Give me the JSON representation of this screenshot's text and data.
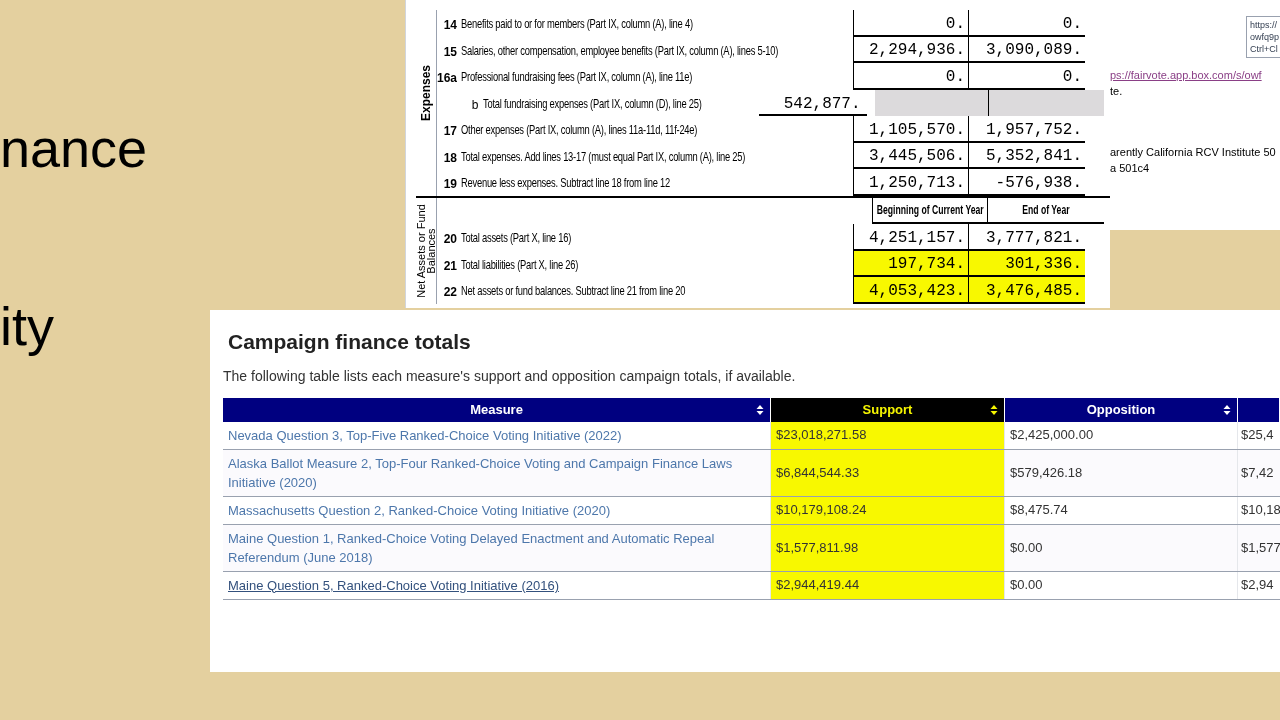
{
  "slide": {
    "texts": [
      "nance",
      "ity"
    ]
  },
  "form": {
    "sections": [
      {
        "label": "Expenses",
        "rows": [
          {
            "kind": "line",
            "number": "14",
            "text": "Benefits paid to or for members (Part IX, column (A), line 4)",
            "beginning": "0.",
            "end": "0.",
            "highlighted": false
          },
          {
            "kind": "line",
            "number": "15",
            "text": "Salaries, other compensation, employee benefits (Part IX, column (A), lines 5-10)",
            "beginning": "2,294,936.",
            "end": "3,090,089.",
            "highlighted": false
          },
          {
            "kind": "line",
            "number": "16a",
            "text": "Professional fundraising fees (Part IX, column (A), line 11e)",
            "beginning": "0.",
            "end": "0.",
            "highlighted": false
          },
          {
            "kind": "subline",
            "number": "b",
            "text": "Total fundraising expenses (Part IX, column (D), line 25)",
            "inner": "542,877."
          },
          {
            "kind": "line",
            "number": "17",
            "text": "Other expenses (Part IX, column (A), lines 11a-11d, 11f-24e)",
            "beginning": "1,105,570.",
            "end": "1,957,752.",
            "highlighted": false
          },
          {
            "kind": "line",
            "number": "18",
            "text": "Total expenses. Add lines 13-17 (must equal Part IX, column (A), line 25)",
            "beginning": "3,445,506.",
            "end": "5,352,841.",
            "highlighted": false
          },
          {
            "kind": "line",
            "number": "19",
            "text": "Revenue less expenses. Subtract line 18 from line 12",
            "beginning": "1,250,713.",
            "end": "-576,938.",
            "highlighted": false
          }
        ]
      },
      {
        "label": "Net Assets or Fund Balances",
        "rows": [
          {
            "kind": "header",
            "beginning": "Beginning of Current Year",
            "end": "End of Year"
          },
          {
            "kind": "line",
            "number": "20",
            "text": "Total assets (Part X, line 16)",
            "beginning": "4,251,157.",
            "end": "3,777,821.",
            "highlighted": false
          },
          {
            "kind": "line",
            "number": "21",
            "text": "Total liabilities (Part X, line 26)",
            "beginning": "197,734.",
            "end": "301,336.",
            "highlighted": true
          },
          {
            "kind": "line",
            "number": "22",
            "text": "Net assets or fund balances. Subtract line 21 from line 20",
            "beginning": "4,053,423.",
            "end": "3,476,485.",
            "highlighted": true
          }
        ]
      }
    ]
  },
  "note": {
    "tooltip": [
      "https://",
      "owfq9p",
      "Ctrl+Cl"
    ],
    "link": "ps://fairvote.app.box.com/s/owf",
    "lines": [
      "te.",
      "arently California RCV Institute 50",
      "a 501c4"
    ]
  },
  "web": {
    "title": "Campaign finance totals",
    "description": "The following table lists each measure's support and opposition campaign totals, if available.",
    "columns": [
      {
        "label": "Measure",
        "highlighted": false
      },
      {
        "label": "Support",
        "highlighted": true
      },
      {
        "label": "Opposition",
        "highlighted": false
      },
      {
        "highlighted": false
      }
    ],
    "rows": [
      {
        "measure": "Nevada Question 3, Top-Five Ranked-Choice Voting Initiative (2022)",
        "hovered": false,
        "support": "$23,018,271.58",
        "support_highlighted": true,
        "opposition": "$2,425,000.00",
        "column_4": "$25,4"
      },
      {
        "measure": "Alaska Ballot Measure 2, Top-Four Ranked-Choice Voting and Campaign Finance Laws Initiative (2020)",
        "hovered": false,
        "support": "$6,844,544.33",
        "support_highlighted": true,
        "opposition": "$579,426.18",
        "column_4": "$7,42"
      },
      {
        "measure": "Massachusetts Question 2, Ranked-Choice Voting Initiative (2020)",
        "hovered": false,
        "support": "$10,179,108.24",
        "support_highlighted": true,
        "opposition": "$8,475.74",
        "column_4": "$10,18"
      },
      {
        "measure": "Maine Question 1, Ranked-Choice Voting Delayed Enactment and Automatic Repeal Referendum (June 2018)",
        "hovered": false,
        "support": "$1,577,811.98",
        "support_highlighted": true,
        "opposition": "$0.00",
        "column_4": "$1,577"
      },
      {
        "measure": "Maine Question 5, Ranked-Choice Voting Initiative (2016)",
        "hovered": true,
        "support": "$2,944,419.44",
        "support_highlighted": true,
        "opposition": "$0.00",
        "column_4": "$2,94"
      }
    ]
  }
}
